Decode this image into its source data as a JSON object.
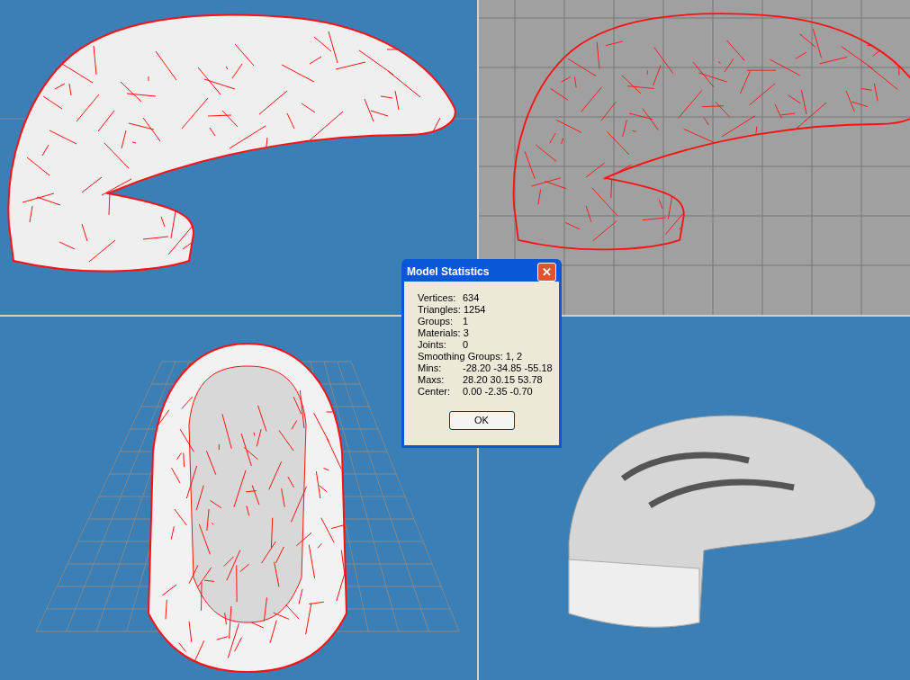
{
  "viewports": [
    {
      "kind": "wireframe-shaded"
    },
    {
      "kind": "wireframe"
    },
    {
      "kind": "wireframe-front"
    },
    {
      "kind": "shaded"
    }
  ],
  "dialog": {
    "title": "Model Statistics",
    "close": "✕",
    "rows": [
      {
        "label": "Vertices:",
        "value": "634"
      },
      {
        "label": "Triangles:",
        "value": "1254"
      },
      {
        "label": "Groups:",
        "value": "1"
      },
      {
        "label": "Materials:",
        "value": "3"
      },
      {
        "label": "Joints:",
        "value": "0"
      },
      {
        "label": "Smoothing Groups:",
        "value": "1, 2"
      },
      {
        "label": "Mins:",
        "value": "-28.20 -34.85 -55.18"
      },
      {
        "label": "Maxs:",
        "value": "28.20 30.15 53.78"
      },
      {
        "label": "Center:",
        "value": "0.00 -2.35 -0.70"
      }
    ],
    "button": "OK"
  }
}
